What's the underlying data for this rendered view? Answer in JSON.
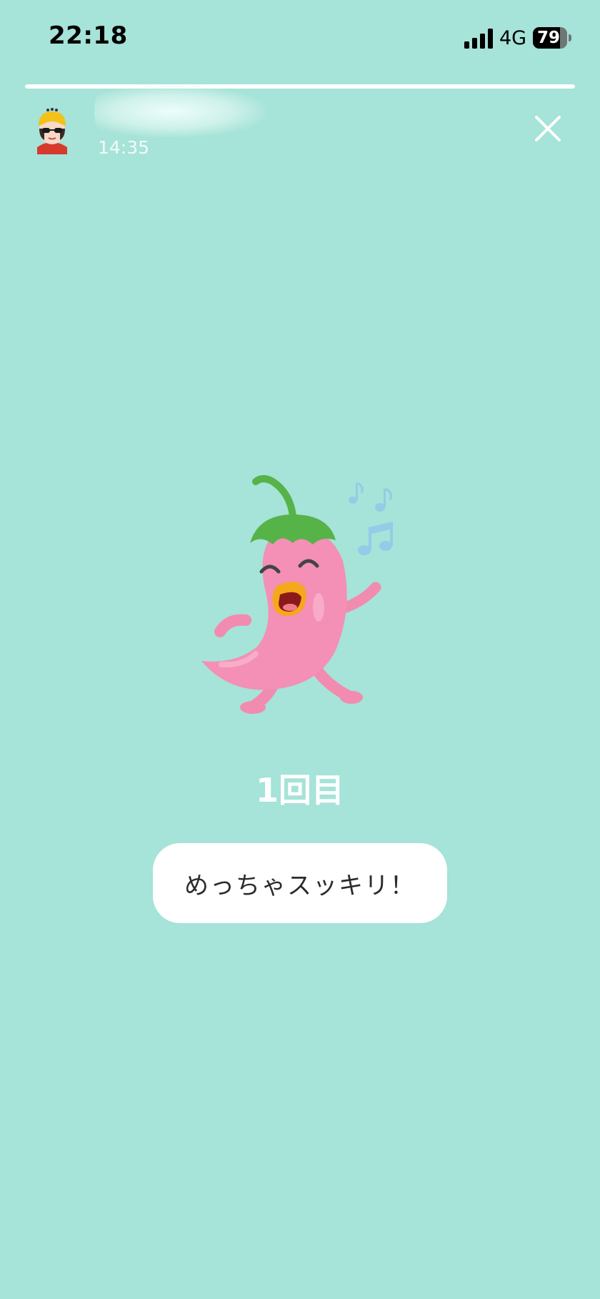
{
  "status_bar": {
    "time": "22:18",
    "network": "4G",
    "battery": "79",
    "battery_level": 0.79
  },
  "story": {
    "progress": 1.0,
    "post_time": "14:35",
    "close_icon": "close-icon",
    "avatar_icon": "avatar-icon"
  },
  "content": {
    "mascot_icon": "pepper-mascot-icon",
    "count_label": "1回目",
    "feeling_label": "めっちゃスッキリ！"
  },
  "colors": {
    "background": "#a6e3d8",
    "pill": "#ffffff",
    "count_text": "#ffffff"
  }
}
